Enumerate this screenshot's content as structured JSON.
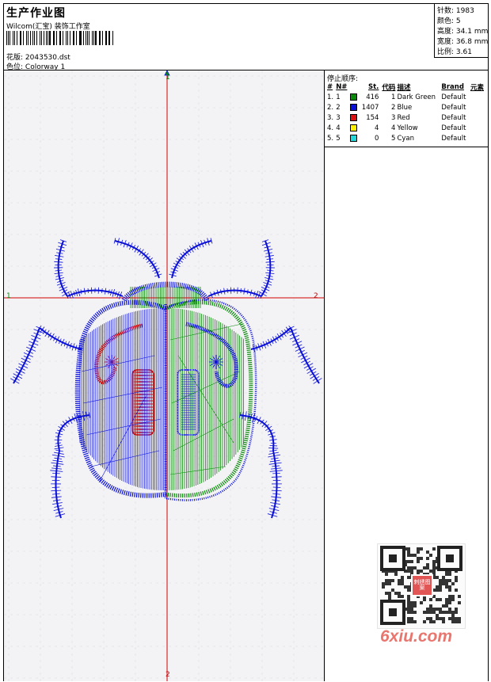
{
  "header": {
    "title": "生产作业图",
    "company": "Wilcom(汇宝) 装饰工作室",
    "design_label": "花版:",
    "design_file": "2043530.dst",
    "colorway_label": "色位:",
    "colorway": "Colorway 1"
  },
  "stats": [
    {
      "label": "针数:",
      "value": "1983"
    },
    {
      "label": "颜色:",
      "value": "5"
    },
    {
      "label": "高度:",
      "value": "34.1 mm"
    },
    {
      "label": "宽度:",
      "value": "36.8 mm"
    },
    {
      "label": "比例:",
      "value": "3.61"
    }
  ],
  "canvas": {
    "axis_start_label": "1",
    "axis_end_label": "2",
    "background": "#f3f2f5",
    "grid_color": "#dcdce4",
    "axis_colors": {
      "vertical": "#d40000",
      "horizontal": "#d40000",
      "start_marker": "#0a8a0a"
    }
  },
  "stop_sequence": {
    "title": "停止顺序:",
    "columns": [
      "#",
      "N#",
      "St.",
      "代码",
      "描述",
      "Brand",
      "元素"
    ],
    "rows": [
      {
        "index": "1.",
        "n": "1",
        "color": "#0a8a0a",
        "stitches": "416",
        "code": "1",
        "description": "Dark Green",
        "brand": "Default",
        "element": ""
      },
      {
        "index": "2.",
        "n": "2",
        "color": "#0a10d8",
        "stitches": "1407",
        "code": "2",
        "description": "Blue",
        "brand": "Default",
        "element": ""
      },
      {
        "index": "3.",
        "n": "3",
        "color": "#dd1111",
        "stitches": "154",
        "code": "3",
        "description": "Red",
        "brand": "Default",
        "element": ""
      },
      {
        "index": "4.",
        "n": "4",
        "color": "#ffee00",
        "stitches": "4",
        "code": "4",
        "description": "Yellow",
        "brand": "Default",
        "element": ""
      },
      {
        "index": "5.",
        "n": "5",
        "color": "#22d8d8",
        "stitches": "0",
        "code": "5",
        "description": "Cyan",
        "brand": "Default",
        "element": ""
      }
    ]
  },
  "watermark": {
    "site": "6xiu.com",
    "stamp_text": "刺绣图案"
  }
}
